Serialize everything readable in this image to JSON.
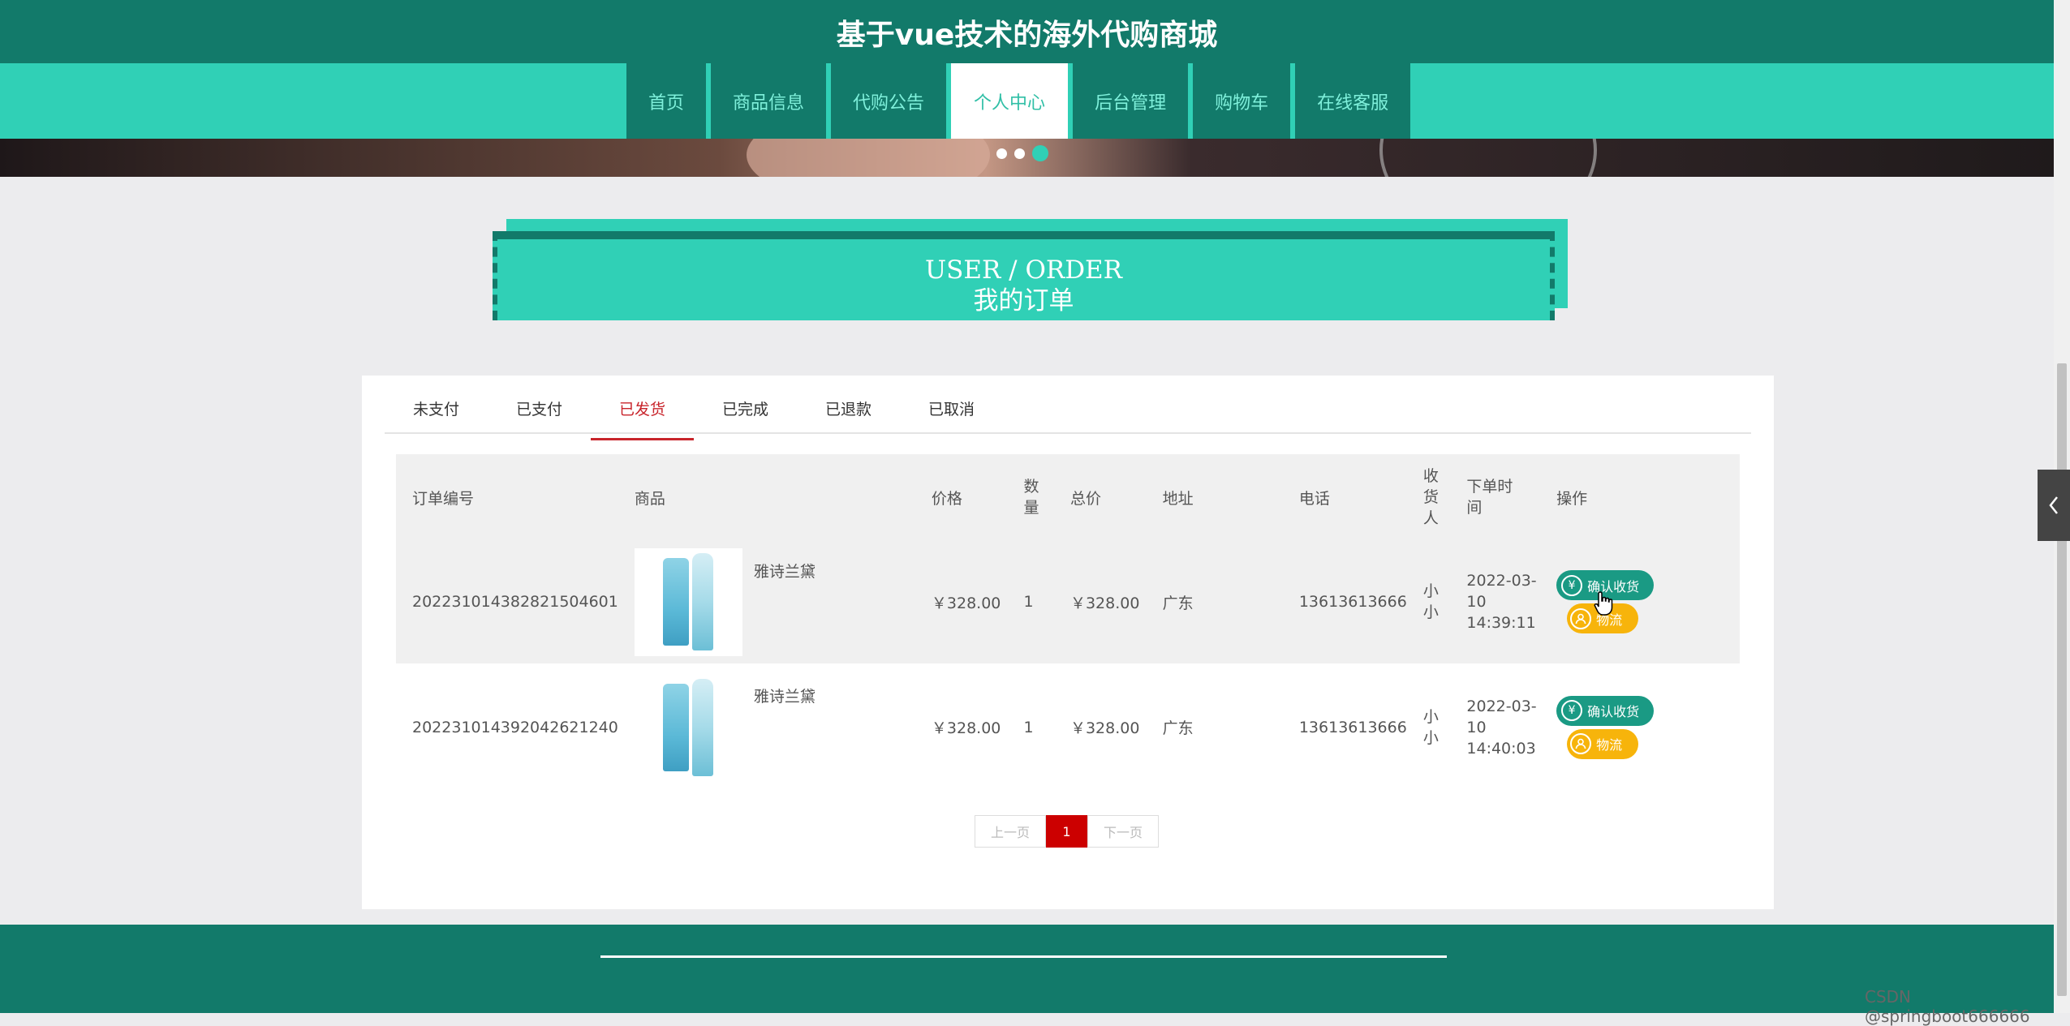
{
  "header": {
    "site_title": "基于vue技术的海外代购商城"
  },
  "nav": {
    "items": [
      {
        "label": "首页"
      },
      {
        "label": "商品信息"
      },
      {
        "label": "代购公告"
      },
      {
        "label": "个人中心",
        "active": true
      },
      {
        "label": "后台管理"
      },
      {
        "label": "购物车"
      },
      {
        "label": "在线客服"
      }
    ]
  },
  "carousel": {
    "dot_count": 3,
    "active_index": 2
  },
  "section_title": {
    "en": "USER / ORDER",
    "cn": "我的订单"
  },
  "tabs": [
    {
      "label": "未支付"
    },
    {
      "label": "已支付"
    },
    {
      "label": "已发货",
      "active": true
    },
    {
      "label": "已完成"
    },
    {
      "label": "已退款"
    },
    {
      "label": "已取消"
    }
  ],
  "table": {
    "headers": {
      "order_no": "订单编号",
      "product": "商品",
      "price": "价格",
      "qty": "数量",
      "total": "总价",
      "address": "地址",
      "phone": "电话",
      "receiver": "收货人",
      "order_time": "下单时间",
      "actions": "操作"
    },
    "rows": [
      {
        "order_no": "202231014382821504601",
        "product_name": "雅诗兰黛",
        "price": "￥328.00",
        "qty": "1",
        "total": "￥328.00",
        "address": "广东",
        "phone": "13613613666",
        "receiver": "小小",
        "time_date": "2022-03-10",
        "time_clock": "14:39:11",
        "confirm_label": "确认收货",
        "logistics_label": "物流"
      },
      {
        "order_no": "202231014392042621240",
        "product_name": "雅诗兰黛",
        "price": "￥328.00",
        "qty": "1",
        "total": "￥328.00",
        "address": "广东",
        "phone": "13613613666",
        "receiver": "小小",
        "time_date": "2022-03-10",
        "time_clock": "14:40:03",
        "confirm_label": "确认收货",
        "logistics_label": "物流"
      }
    ]
  },
  "pagination": {
    "prev_label": "上一页",
    "current_page": "1",
    "next_label": "下一页"
  },
  "watermark": "CSDN @springboot666666",
  "colors": {
    "primary_dark": "#127a6a",
    "primary_light": "#30d0b6",
    "accent_red": "#c8242b",
    "logistics_yellow": "#f7b40b"
  },
  "icons": {
    "confirm": "yen-icon",
    "logistics": "user-icon",
    "side_toggle": "chevron-left-icon",
    "cursor": "hand-pointer-icon"
  }
}
